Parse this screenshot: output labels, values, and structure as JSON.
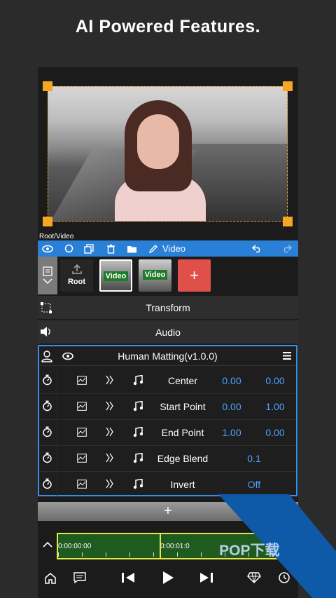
{
  "headline": "AI Powered Features.",
  "path_label": "Root/Video",
  "toolbar": {
    "title": "Video"
  },
  "media": {
    "root_label": "Root",
    "clip1_label": "Video",
    "clip2_label": "Video",
    "add_label": "+"
  },
  "sections": {
    "transform": "Transform",
    "audio": "Audio"
  },
  "effect": {
    "title": "Human Matting(v1.0.0)",
    "params": [
      {
        "name": "Center",
        "value1": "0.00",
        "value2": "0.00"
      },
      {
        "name": "Start Point",
        "value1": "0.00",
        "value2": "1.00"
      },
      {
        "name": "End Point",
        "value1": "1.00",
        "value2": "0.00"
      },
      {
        "name": "Edge Blend",
        "value": "0.1"
      },
      {
        "name": "Invert",
        "value": "Off"
      }
    ]
  },
  "add_effect_label": "+",
  "timeline": {
    "start_time": "0:00:00:00",
    "current_time": "0:00:01:0"
  },
  "watermark": "PCPOP下载",
  "colors": {
    "accent": "#2a7fd6",
    "value": "#4ea1ff",
    "handle": "#f6a623",
    "track": "#1f5a1f",
    "playhead": "#e6e64a",
    "add_clip": "#e0504a"
  }
}
